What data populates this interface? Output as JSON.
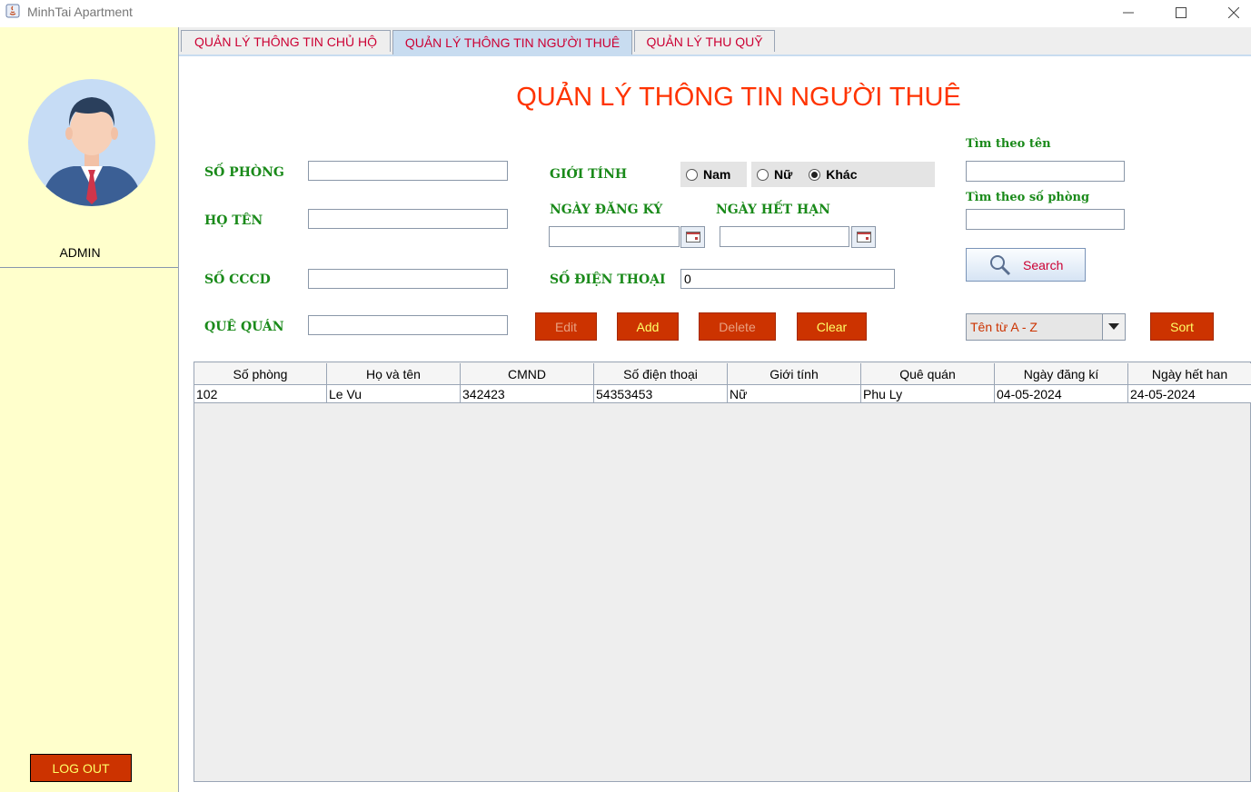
{
  "window": {
    "title": "MinhTai Apartment"
  },
  "sidebar": {
    "user": "ADMIN",
    "logout_label": "LOG OUT"
  },
  "tabs": [
    {
      "label": "QUẢN LÝ THÔNG TIN CHỦ HỘ"
    },
    {
      "label": "QUẢN LÝ THÔNG TIN NGƯỜI THUÊ"
    },
    {
      "label": "QUẢN LÝ THU QUỸ"
    }
  ],
  "page_title": "QUẢN LÝ THÔNG TIN NGƯỜI THUÊ",
  "form": {
    "so_phong_label": "SỐ PHÒNG",
    "ho_ten_label": "HỌ TÊN",
    "so_cccd_label": "SỐ CCCD",
    "que_quan_label": "QUÊ QUÁN",
    "gioi_tinh_label": "GIỚI TÍNH",
    "ngay_dang_ky_label": "NGÀY ĐĂNG KÝ",
    "ngay_het_han_label": "NGÀY HẾT HẠN",
    "so_dien_thoai_label": "SỐ ĐIỆN THOẠI",
    "so_phong_value": "",
    "ho_ten_value": "",
    "so_cccd_value": "",
    "que_quan_value": "",
    "ngay_dang_ky_value": "",
    "ngay_het_han_value": "",
    "so_dien_thoai_value": "0",
    "gender_options": [
      "Nam",
      "Nữ",
      "Khác"
    ],
    "gender_selected": "Khác"
  },
  "actions": {
    "edit": "Edit",
    "add": "Add",
    "delete": "Delete",
    "clear": "Clear"
  },
  "search": {
    "by_name_label": "Tìm theo tên",
    "by_room_label": "Tìm theo số phòng",
    "by_name_value": "",
    "by_room_value": "",
    "button_label": "Search"
  },
  "sort": {
    "selected": "Tên từ A - Z",
    "button_label": "Sort"
  },
  "table": {
    "columns": [
      "Số phòng",
      "Họ và tên",
      "CMND",
      "Số điện thoại",
      "Giới tính",
      "Quê quán",
      "Ngày đăng kí",
      "Ngày hết han"
    ],
    "rows": [
      [
        "102",
        "Le Vu",
        "342423",
        "54353453",
        "Nữ",
        "Phu Ly",
        "04-05-2024",
        "24-05-2024"
      ]
    ]
  },
  "colors": {
    "accent_red": "#cc3300",
    "tab_text": "#cc0033",
    "label_green": "#1a8a1a",
    "sidebar_bg": "#ffffcc",
    "title_red": "#ff3300"
  }
}
